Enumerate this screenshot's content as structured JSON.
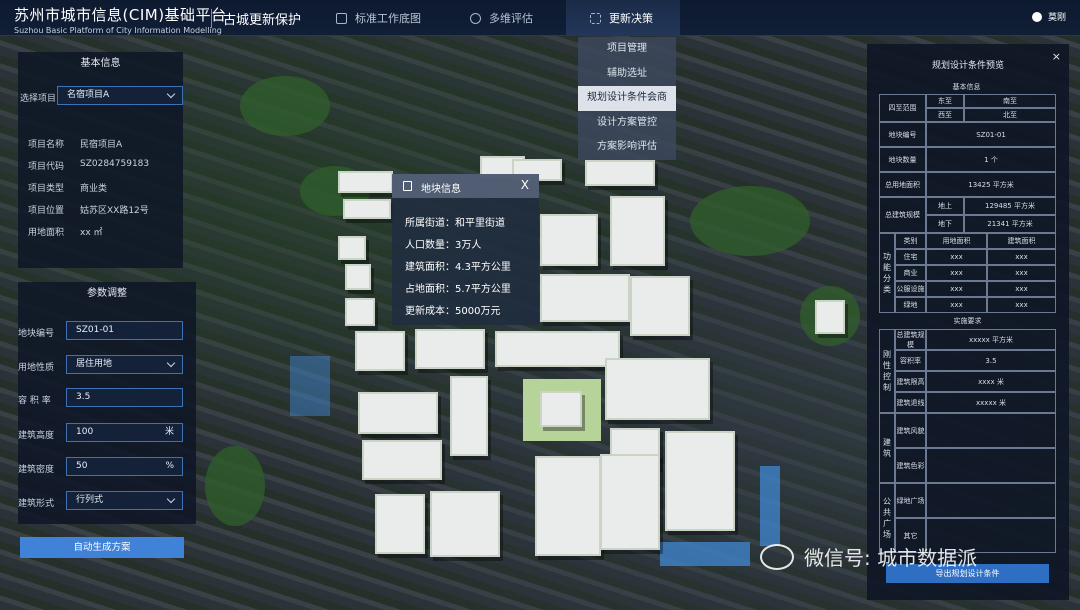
{
  "header": {
    "title_cn": "苏州市城市信息(CIM)基础平台",
    "title_en": "Suzhou Basic Platform of City Information Modelling",
    "subtitle": "古城更新保护",
    "nav": [
      {
        "label": "标准工作底图",
        "icon": "map-layer-icon"
      },
      {
        "label": "多维评估",
        "icon": "evaluate-icon"
      },
      {
        "label": "更新决策",
        "icon": "grid-icon"
      }
    ],
    "user": "莫刚"
  },
  "menu": {
    "items": [
      "项目管理",
      "辅助选址",
      "规划设计条件会商",
      "设计方案管控",
      "方案影响评估"
    ],
    "selected": "规划设计条件会商"
  },
  "basic_info": {
    "title": "基本信息",
    "select_label": "选择项目",
    "select_value": "名宿项目A",
    "rows": [
      {
        "k": "项目名称",
        "v": "民宿项目A"
      },
      {
        "k": "项目代码",
        "v": "SZ0284759183"
      },
      {
        "k": "项目类型",
        "v": "商业类"
      },
      {
        "k": "项目位置",
        "v": "姑苏区XX路12号"
      },
      {
        "k": "用地面积",
        "v": "xx ㎡"
      }
    ]
  },
  "params": {
    "title": "参数调整",
    "fields": [
      {
        "label": "地块编号",
        "value": "SZ01-01",
        "suffix": "",
        "select": false
      },
      {
        "label": "用地性质",
        "value": "居住用地",
        "suffix": "",
        "select": true
      },
      {
        "label": "容 积 率",
        "value": "3.5",
        "suffix": "",
        "select": false
      },
      {
        "label": "建筑高度",
        "value": "100",
        "suffix": "米",
        "select": false
      },
      {
        "label": "建筑密度",
        "value": "50",
        "suffix": "%",
        "select": false
      },
      {
        "label": "建筑形式",
        "value": "行列式",
        "suffix": "",
        "select": true
      }
    ],
    "button": "自动生成方案"
  },
  "popup": {
    "title": "地块信息",
    "close": "X",
    "rows": [
      {
        "k": "所属街道",
        "v": "和平里街道"
      },
      {
        "k": "人口数量",
        "v": "3万人"
      },
      {
        "k": "建筑面积",
        "v": "4.3平方公里"
      },
      {
        "k": "占地面积",
        "v": "5.7平方公里"
      },
      {
        "k": "更新成本",
        "v": "5000万元"
      }
    ]
  },
  "right_panel": {
    "title": "规划设计条件预览",
    "close": "×",
    "sec1": "基本信息",
    "sizhi_label": "四至范围",
    "sizhi": [
      "东至",
      "南至",
      "西至",
      "北至"
    ],
    "plot_label": "地块编号",
    "plot_value": "SZ01-01",
    "count_label": "地块数量",
    "count_value": "1 个",
    "total_label": "总用地面积",
    "total_value": "13425 平方米",
    "gfa_label": "总建筑规模",
    "gfa": [
      {
        "k": "地上",
        "v": "129485 平方米"
      },
      {
        "k": "地下",
        "v": "21341 平方米"
      }
    ],
    "func_label": "功能分类",
    "func_head": [
      "类别",
      "用地面积",
      "建筑面积"
    ],
    "func_rows": [
      [
        "住宅",
        "xxx",
        "xxx"
      ],
      [
        "商业",
        "xxx",
        "xxx"
      ],
      [
        "公服设施",
        "xxx",
        "xxx"
      ],
      [
        "绿地",
        "xxx",
        "xxx"
      ]
    ],
    "sec2": "实施要求",
    "rigid_label": "刚性控制",
    "rigid_rows": [
      {
        "k": "总建筑规模",
        "v": "xxxxx 平方米"
      },
      {
        "k": "容积率",
        "v": "3.5"
      },
      {
        "k": "建筑限高",
        "v": "xxxx 米"
      },
      {
        "k": "建筑退线",
        "v": "xxxxx 米"
      }
    ],
    "build_label": "建筑",
    "build_rows": [
      "建筑风貌",
      "建筑色彩"
    ],
    "pub_label": "公共广场",
    "pub_rows": [
      "绿地广场",
      "其它"
    ],
    "button": "导出规划设计条件"
  },
  "watermark": "微信号: 城市数据派"
}
